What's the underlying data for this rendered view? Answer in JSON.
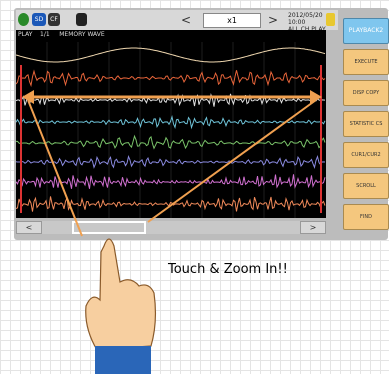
{
  "topbar": {
    "badge2": "SD",
    "badge3": "CF",
    "left_arrow": "<",
    "right_arrow": ">",
    "zoom_value": "x1",
    "status_line1": "2012/05/20 10:00",
    "status_line2": "ALL CH PLAY"
  },
  "screen": {
    "header": "PLAY    1/1     MEMORY WAVE"
  },
  "side_buttons": [
    {
      "label": "PLAYBACK2",
      "active": true
    },
    {
      "label": "EXECUTE",
      "active": false
    },
    {
      "label": "DISP COPY",
      "active": false
    },
    {
      "label": "STATISTIC CS",
      "active": false
    },
    {
      "label": "CUR1/CUR2",
      "active": false
    },
    {
      "label": "SCROLL",
      "active": false
    },
    {
      "label": "FIND",
      "active": false
    }
  ],
  "scroll": {
    "left": "<",
    "right": ">"
  },
  "caption": "Touch & Zoom In!!",
  "colors": {
    "screen_bg": "#000000",
    "side_button": "#f4c77e",
    "side_button_active": "#7fc6ee",
    "arrow": "#f0a050",
    "skin": "#f7cfa0",
    "sleeve": "#2a66b8"
  }
}
